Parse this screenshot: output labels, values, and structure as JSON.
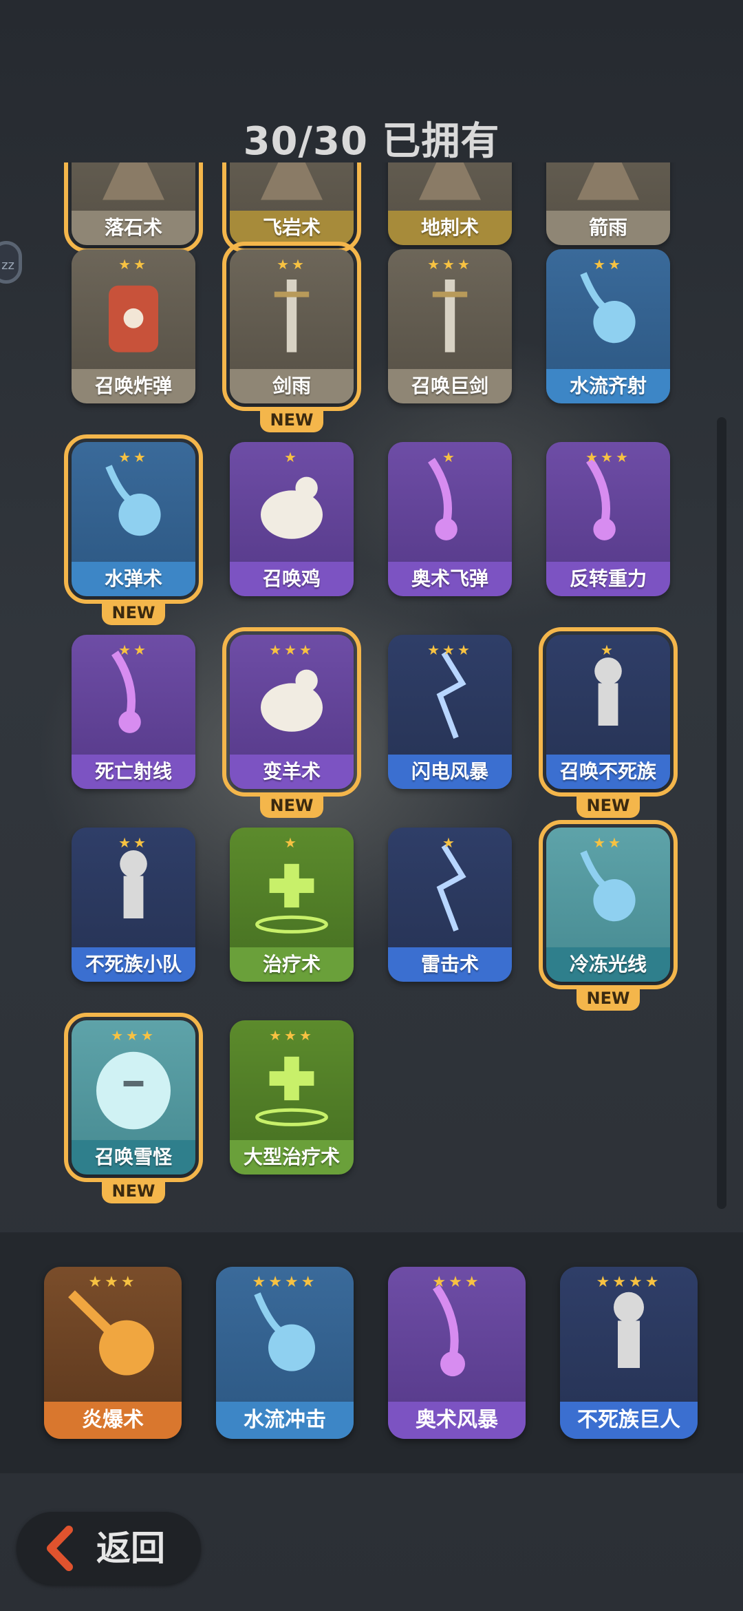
{
  "header": {
    "owned_count": "30/30 已拥有"
  },
  "side_badge": {
    "text": "zz"
  },
  "grid_cards": [
    {
      "name": "落石术",
      "stars": "",
      "theme": "stone",
      "selected": true,
      "new": true,
      "icon": "rock-icon"
    },
    {
      "name": "飞岩术",
      "stars": "",
      "theme": "gold",
      "selected": true,
      "new": true,
      "icon": "flying-rock-icon"
    },
    {
      "name": "地刺术",
      "stars": "",
      "theme": "gold",
      "selected": false,
      "new": false,
      "icon": "earth-spike-icon"
    },
    {
      "name": "箭雨",
      "stars": "",
      "theme": "stone",
      "selected": false,
      "new": false,
      "icon": "arrow-rain-icon"
    },
    {
      "name": "召唤炸弹",
      "stars": "★★",
      "theme": "stone",
      "selected": false,
      "new": false,
      "icon": "bomb-barrel-icon"
    },
    {
      "name": "剑雨",
      "stars": "★★",
      "theme": "stone",
      "selected": true,
      "new": true,
      "icon": "sword-rain-icon"
    },
    {
      "name": "召唤巨剑",
      "stars": "★★★",
      "theme": "stone",
      "selected": false,
      "new": false,
      "icon": "giant-sword-icon"
    },
    {
      "name": "水流齐射",
      "stars": "★★",
      "theme": "water",
      "selected": false,
      "new": false,
      "icon": "water-volley-icon"
    },
    {
      "name": "水弹术",
      "stars": "★★",
      "theme": "water",
      "selected": true,
      "new": true,
      "icon": "water-ball-icon"
    },
    {
      "name": "召唤鸡",
      "stars": "★",
      "theme": "purple",
      "selected": false,
      "new": false,
      "icon": "chicken-icon"
    },
    {
      "name": "奥术飞弹",
      "stars": "★",
      "theme": "purple",
      "selected": false,
      "new": false,
      "icon": "arcane-missile-icon"
    },
    {
      "name": "反转重力",
      "stars": "★★★",
      "theme": "purple",
      "selected": false,
      "new": false,
      "icon": "reverse-gravity-icon"
    },
    {
      "name": "死亡射线",
      "stars": "★★",
      "theme": "purple",
      "selected": false,
      "new": false,
      "icon": "death-ray-icon"
    },
    {
      "name": "变羊术",
      "stars": "★★★",
      "theme": "purple",
      "selected": true,
      "new": true,
      "icon": "sheep-icon"
    },
    {
      "name": "闪电风暴",
      "stars": "★★★",
      "theme": "storm",
      "selected": false,
      "new": false,
      "icon": "lightning-storm-icon"
    },
    {
      "name": "召唤不死族",
      "stars": "★",
      "theme": "storm",
      "selected": true,
      "new": true,
      "icon": "skeleton-icon"
    },
    {
      "name": "不死族小队",
      "stars": "★★",
      "theme": "storm",
      "selected": false,
      "new": false,
      "icon": "skeleton-squad-icon"
    },
    {
      "name": "治疗术",
      "stars": "★",
      "theme": "green",
      "selected": false,
      "new": false,
      "icon": "heal-icon"
    },
    {
      "name": "雷击术",
      "stars": "★",
      "theme": "storm",
      "selected": false,
      "new": false,
      "icon": "lightning-strike-icon"
    },
    {
      "name": "冷冻光线",
      "stars": "★★",
      "theme": "ice",
      "selected": true,
      "new": true,
      "icon": "frost-ray-icon"
    },
    {
      "name": "召唤雪怪",
      "stars": "★★★",
      "theme": "ice",
      "selected": true,
      "new": true,
      "icon": "yeti-icon"
    },
    {
      "name": "大型治疗术",
      "stars": "★★★",
      "theme": "green",
      "selected": false,
      "new": false,
      "icon": "big-heal-icon"
    }
  ],
  "new_label": "NEW",
  "equipped": [
    {
      "name": "炎爆术",
      "stars": "★★★",
      "theme": "fire",
      "icon": "fireball-icon"
    },
    {
      "name": "水流冲击",
      "stars": "★★★★",
      "theme": "water",
      "icon": "water-blast-icon"
    },
    {
      "name": "奥术风暴",
      "stars": "★★★",
      "theme": "purple",
      "icon": "arcane-storm-icon"
    },
    {
      "name": "不死族巨人",
      "stars": "★★★★",
      "theme": "storm",
      "icon": "skeleton-giant-icon"
    }
  ],
  "footer": {
    "back_label": "返回"
  }
}
